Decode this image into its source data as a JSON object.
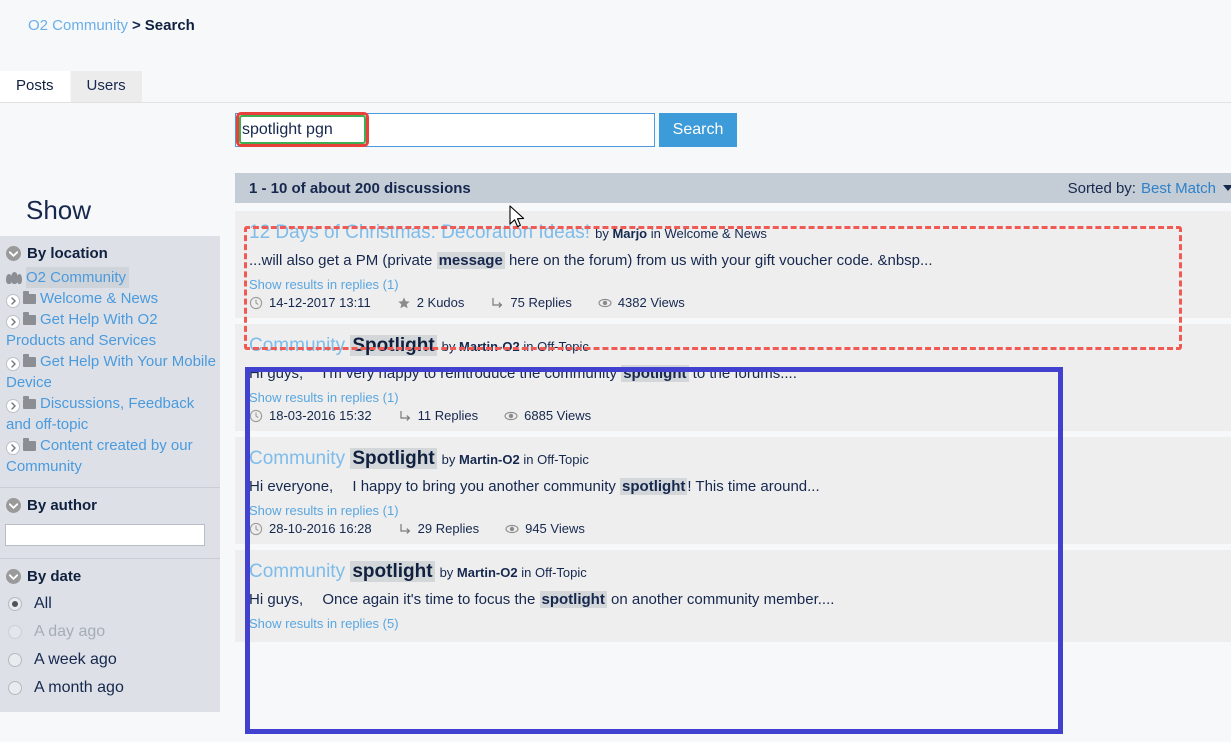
{
  "breadcrumb": {
    "root": "O2 Community",
    "separator": ">",
    "current": "Search"
  },
  "tabs": [
    {
      "label": "Posts",
      "active": true
    },
    {
      "label": "Users",
      "active": false
    }
  ],
  "search": {
    "value": "spotlight pgn",
    "placeholder": "",
    "button_label": "Search"
  },
  "results_header": {
    "count_text": "1 - 10 of about 200 discussions",
    "sorted_by_label": "Sorted by:",
    "sorted_by_value": "Best Match",
    "sort_caret_icon": "chevron-down-icon"
  },
  "sidebar": {
    "title": "Show",
    "by_location": {
      "label": "By location",
      "toggle_icon": "chevron-down-circle-icon",
      "root": {
        "label": "O2 Community",
        "icon": "people-icon"
      },
      "items": [
        {
          "label": "Welcome & News",
          "icon": "folder-icon",
          "expand_icon": "chevron-right-circle-icon"
        },
        {
          "label": "Get Help With O2 Products and Services",
          "icon": "folder-icon",
          "expand_icon": "chevron-right-circle-icon"
        },
        {
          "label": "Get Help With Your Mobile Device",
          "icon": "folder-icon",
          "expand_icon": "chevron-right-circle-icon"
        },
        {
          "label": "Discussions, Feedback and off-topic",
          "icon": "folder-icon",
          "expand_icon": "chevron-right-circle-icon"
        },
        {
          "label": "Content created by our Community",
          "icon": "folder-icon",
          "expand_icon": "chevron-right-circle-icon"
        }
      ]
    },
    "by_author": {
      "label": "By author",
      "toggle_icon": "chevron-down-circle-icon",
      "input_value": "",
      "input_placeholder": ""
    },
    "by_date": {
      "label": "By date",
      "toggle_icon": "chevron-down-circle-icon",
      "options": [
        {
          "label": "All",
          "checked": true,
          "disabled": false
        },
        {
          "label": "A day ago",
          "checked": false,
          "disabled": true
        },
        {
          "label": "A week ago",
          "checked": false,
          "disabled": false
        },
        {
          "label": "A month ago",
          "checked": false,
          "disabled": false
        }
      ]
    }
  },
  "results": [
    {
      "title_plain": "12 Days of Christmas: Decoration Ideas!",
      "title_parts": [
        {
          "text": "12 Days of Christmas: Decoration Ideas!",
          "highlight": false
        }
      ],
      "by_label": "by",
      "author": "Marjo",
      "in_label": "in",
      "board": "Welcome & News",
      "snippet_parts": [
        {
          "text": "...will also get a PM (private ",
          "highlight": false
        },
        {
          "text": "message",
          "highlight": true
        },
        {
          "text": " here on the forum) from us with your gift voucher code. &nbsp...",
          "highlight": false
        }
      ],
      "replies_link": "Show results in replies (1)",
      "meta": [
        {
          "icon": "clock-icon",
          "text": "14-12-2017 13:11"
        },
        {
          "icon": "star-icon",
          "text": "2 Kudos"
        },
        {
          "icon": "reply-arrow-icon",
          "text": "75 Replies"
        },
        {
          "icon": "eye-icon",
          "text": "4382 Views"
        }
      ]
    },
    {
      "title_plain": "Community Spotlight",
      "title_parts": [
        {
          "text": "Community ",
          "highlight": false
        },
        {
          "text": "Spotlight",
          "highlight": true
        }
      ],
      "by_label": "by",
      "author": "Martin-O2",
      "in_label": "in",
      "board": "Off-Topic",
      "snippet_parts": [
        {
          "text": "Hi guys,  I'm very happy to reintroduce the community ",
          "highlight": false
        },
        {
          "text": "spotlight",
          "highlight": true
        },
        {
          "text": " to the forums....",
          "highlight": false
        }
      ],
      "replies_link": "Show results in replies (1)",
      "meta": [
        {
          "icon": "clock-icon",
          "text": "18-03-2016 15:32"
        },
        {
          "icon": "reply-arrow-icon",
          "text": "11 Replies"
        },
        {
          "icon": "eye-icon",
          "text": "6885 Views"
        }
      ]
    },
    {
      "title_plain": "Community Spotlight",
      "title_parts": [
        {
          "text": "Community ",
          "highlight": false
        },
        {
          "text": "Spotlight",
          "highlight": true
        }
      ],
      "by_label": "by",
      "author": "Martin-O2",
      "in_label": "in",
      "board": "Off-Topic",
      "snippet_parts": [
        {
          "text": "Hi everyone,  I happy to bring you another community ",
          "highlight": false
        },
        {
          "text": "spotlight",
          "highlight": true
        },
        {
          "text": "! This time around...",
          "highlight": false
        }
      ],
      "replies_link": "Show results in replies (1)",
      "meta": [
        {
          "icon": "clock-icon",
          "text": "28-10-2016 16:28"
        },
        {
          "icon": "reply-arrow-icon",
          "text": "29 Replies"
        },
        {
          "icon": "eye-icon",
          "text": "945 Views"
        }
      ]
    },
    {
      "title_plain": "Community spotlight",
      "title_parts": [
        {
          "text": "Community ",
          "highlight": false
        },
        {
          "text": "spotlight",
          "highlight": true
        }
      ],
      "by_label": "by",
      "author": "Martin-O2",
      "in_label": "in",
      "board": "Off-Topic",
      "snippet_parts": [
        {
          "text": "Hi guys,  Once again it's time to focus the ",
          "highlight": false
        },
        {
          "text": "spotlight",
          "highlight": true
        },
        {
          "text": " on another community member....",
          "highlight": false
        }
      ],
      "replies_link": "Show results in replies (5)",
      "meta": []
    }
  ],
  "annotations": {
    "query_ring_outer_color": "#e8413c",
    "query_ring_inner_color": "#3fae52",
    "red_box_color": "#f05a55",
    "blue_box_color": "#4240cf"
  },
  "colors": {
    "link_blue": "#4a9ade",
    "title_blue": "#7dbceb",
    "navy": "#16284e",
    "button_blue": "#3e9bd9",
    "facet_bg": "#dde1e7",
    "result_bg": "#eeeeee",
    "header_bg": "#c4ccd6"
  }
}
